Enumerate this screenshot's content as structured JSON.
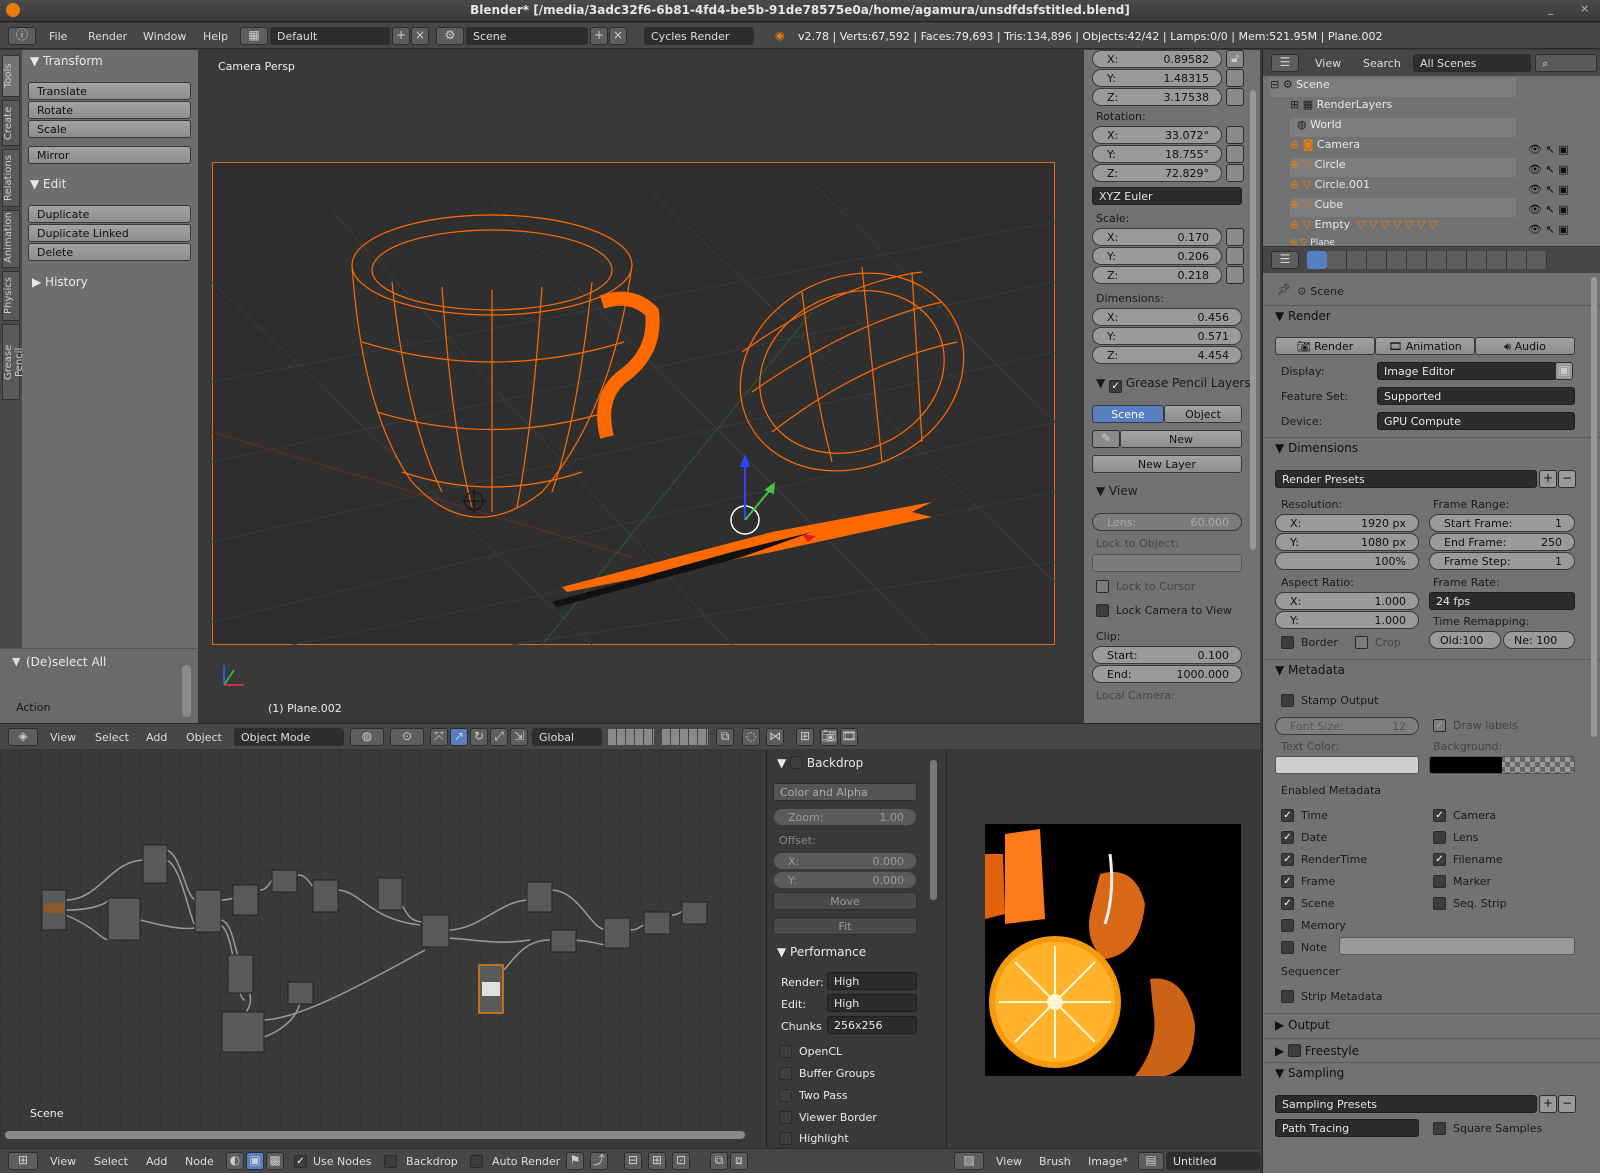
{
  "window": {
    "title": "Blender* [/media/3adc32f6-6b81-4fd4-be5b-91de78575e0a/home/agamura/unsdfdsfstitled.blend]"
  },
  "infobar": {
    "menus": [
      "File",
      "Render",
      "Window",
      "Help"
    ],
    "layout": "Default",
    "scene": "Scene",
    "engine": "Cycles Render",
    "stats": "v2.78 | Verts:67,592 | Faces:79,693 | Tris:134,896 | Objects:42/42 | Lamps:0/0 | Mem:521.95M | Plane.002"
  },
  "tools": {
    "tabs": [
      "Tools",
      "Create",
      "Relations",
      "Animation",
      "Physics",
      "Grease Pencil"
    ],
    "transform": "Transform",
    "translate": "Translate",
    "rotate": "Rotate",
    "scale": "Scale",
    "mirror": "Mirror",
    "edit": "Edit",
    "duplicate": "Duplicate",
    "duplicate_linked": "Duplicate Linked",
    "delete": "Delete",
    "history": "History",
    "operator": "(De)select All",
    "action": "Action"
  },
  "viewport": {
    "label": "Camera Persp",
    "object": "(1) Plane.002",
    "header": {
      "menus": [
        "View",
        "Select",
        "Add",
        "Object"
      ],
      "mode": "Object Mode",
      "orientation": "Global"
    }
  },
  "npanel": {
    "loc": [
      {
        "k": "X:",
        "v": "0.89582"
      },
      {
        "k": "Y:",
        "v": "1.48315"
      },
      {
        "k": "Z:",
        "v": "3.17538"
      }
    ],
    "rotation_label": "Rotation:",
    "rot": [
      {
        "k": "X:",
        "v": "33.072°"
      },
      {
        "k": "Y:",
        "v": "18.755°"
      },
      {
        "k": "Z:",
        "v": "72.829°"
      }
    ],
    "rot_mode": "XYZ Euler",
    "scale_label": "Scale:",
    "scale": [
      {
        "k": "X:",
        "v": "0.170"
      },
      {
        "k": "Y:",
        "v": "0.206"
      },
      {
        "k": "Z:",
        "v": "0.218"
      }
    ],
    "dim_label": "Dimensions:",
    "dim": [
      {
        "k": "X:",
        "v": "0.456"
      },
      {
        "k": "Y:",
        "v": "0.571"
      },
      {
        "k": "Z:",
        "v": "4.454"
      }
    ],
    "gp_layers": "Grease Pencil Layers",
    "scene_btn": "Scene",
    "object_btn": "Object",
    "new": "New",
    "new_layer": "New Layer",
    "view": "View",
    "lens_k": "Lens:",
    "lens_v": "60.000",
    "lock_to_object": "Lock to Object:",
    "lock_cursor": "Lock to Cursor",
    "lock_camera": "Lock Camera to View",
    "clip": "Clip:",
    "start_k": "Start:",
    "start_v": "0.100",
    "end_k": "End:",
    "end_v": "1000.000",
    "local_camera": "Local Camera:"
  },
  "outliner": {
    "header": {
      "view": "View",
      "search": "Search",
      "scenes": "All Scenes"
    },
    "rows": [
      "Scene",
      "RenderLayers",
      "World",
      "Camera",
      "Circle",
      "Circle.001",
      "Cube",
      "Empty",
      "Plane"
    ]
  },
  "props": {
    "crumb": "Scene",
    "render": "Render",
    "render_btn": "Render",
    "animation_btn": "Animation",
    "audio_btn": "Audio",
    "display_k": "Display:",
    "display_v": "Image Editor",
    "feature_k": "Feature Set:",
    "feature_v": "Supported",
    "device_k": "Device:",
    "device_v": "GPU Compute",
    "dimensions": "Dimensions",
    "render_presets": "Render Presets",
    "resolution": "Resolution:",
    "res_x": "1920 px",
    "res_y": "1080 px",
    "res_pct": "100%",
    "frame_range": "Frame Range:",
    "start_frame_k": "Start Frame:",
    "start_frame_v": "1",
    "end_frame_k": "End Frame:",
    "end_frame_v": "250",
    "frame_step_k": "Frame Step:",
    "frame_step_v": "1",
    "aspect": "Aspect Ratio:",
    "asp_x": "1.000",
    "asp_y": "1.000",
    "frame_rate": "Frame Rate:",
    "fps": "24 fps",
    "time_remap": "Time Remapping:",
    "old": "Old:100",
    "new": "Ne: 100",
    "border": "Border",
    "crop": "Crop",
    "metadata": "Metadata",
    "stamp": "Stamp Output",
    "font_size_k": "Font Size:",
    "font_size_v": "12",
    "draw_labels": "Draw labels",
    "text_color": "Text Color:",
    "background": "Background:",
    "enabled_meta": "Enabled Metadata",
    "meta_left": [
      {
        "l": "Time",
        "c": true
      },
      {
        "l": "Date",
        "c": true
      },
      {
        "l": "RenderTime",
        "c": true
      },
      {
        "l": "Frame",
        "c": true
      },
      {
        "l": "Scene",
        "c": true
      },
      {
        "l": "Memory",
        "c": false
      },
      {
        "l": "Note",
        "c": false
      }
    ],
    "meta_right": [
      {
        "l": "Camera",
        "c": true
      },
      {
        "l": "Lens",
        "c": false
      },
      {
        "l": "Filename",
        "c": true
      },
      {
        "l": "Marker",
        "c": false
      },
      {
        "l": "Seq. Strip",
        "c": false
      }
    ],
    "sequencer": "Sequencer",
    "strip_meta": "Strip Metadata",
    "output": "Output",
    "freestyle": "Freestyle",
    "sampling": "Sampling",
    "sampling_presets": "Sampling Presets",
    "path_tracing": "Path Tracing",
    "square_samples": "Square Samples"
  },
  "node": {
    "scene": "Scene",
    "header": {
      "menus": [
        "View",
        "Select",
        "Add",
        "Node"
      ],
      "use_nodes": "Use Nodes",
      "backdrop": "Backdrop",
      "auto_render": "Auto Render"
    }
  },
  "backdrop_panel": {
    "backdrop": "Backdrop",
    "color_alpha": "Color and Alpha",
    "zoom_k": "Zoom:",
    "zoom_v": "1.00",
    "offset": "Offset:",
    "off_x_k": "X:",
    "off_x_v": "0.000",
    "off_y_k": "Y:",
    "off_y_v": "0.000",
    "move": "Move",
    "fit": "Fit",
    "performance": "Performance",
    "render_k": "Render:",
    "render_v": "High",
    "edit_k": "Edit:",
    "edit_v": "High",
    "chunks_k": "Chunks",
    "chunks_v": "256x256",
    "opencl": "OpenCL",
    "buffer_groups": "Buffer Groups",
    "two_pass": "Two Pass",
    "viewer_border": "Viewer Border",
    "highlight": "Highlight"
  },
  "image_editor": {
    "header": {
      "menus": [
        "View",
        "Brush",
        "Image*"
      ],
      "image": "Untitled"
    }
  }
}
